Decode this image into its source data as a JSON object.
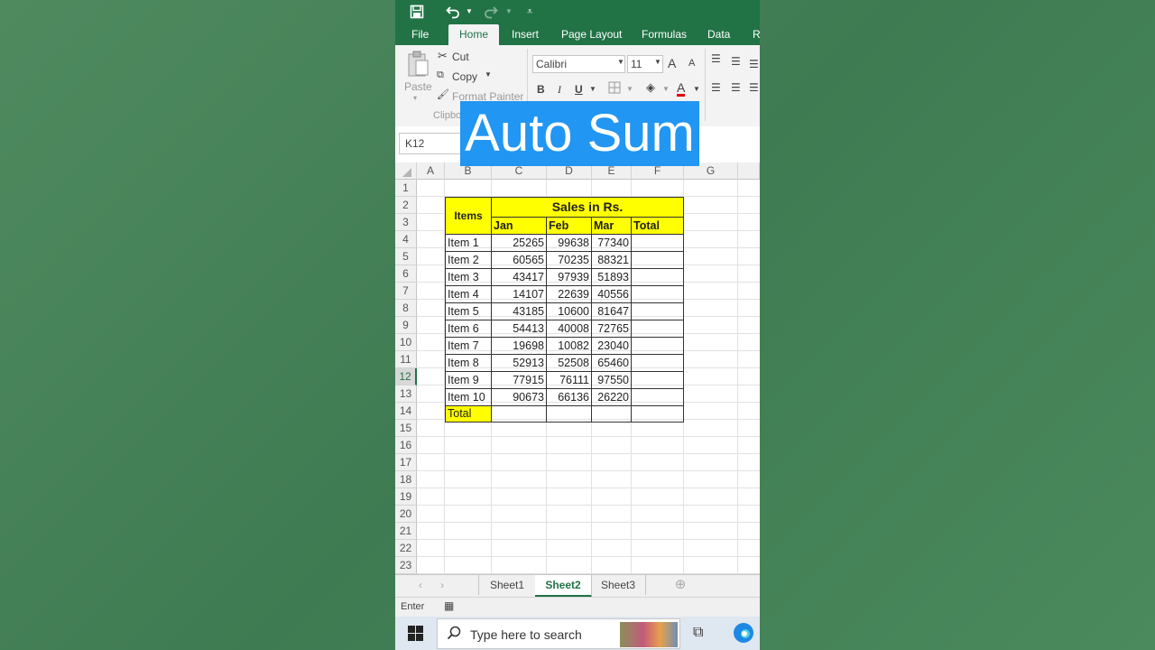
{
  "qat": {
    "save_icon": "save-icon",
    "undo_icon": "undo-icon",
    "redo_icon": "redo-icon",
    "customize_icon": "customize-icon"
  },
  "tabs": [
    "File",
    "Home",
    "Insert",
    "Page Layout",
    "Formulas",
    "Data",
    "R"
  ],
  "active_tab": "Home",
  "ribbon": {
    "paste": "Paste",
    "cut": "Cut",
    "copy": "Copy",
    "format_painter": "Format Painter",
    "clipboard_group": "Clipbo",
    "font_name": "Calibri",
    "font_size": "11",
    "grow_font": "A",
    "shrink_font": "A",
    "bold": "B",
    "italic": "I",
    "underline": "U",
    "font_color": "A"
  },
  "formula_bar": {
    "name_box": "K12"
  },
  "overlay_title": "Auto Sum",
  "columns": [
    "A",
    "B",
    "C",
    "D",
    "E",
    "F",
    "G"
  ],
  "rows": [
    "1",
    "2",
    "3",
    "4",
    "5",
    "6",
    "7",
    "8",
    "9",
    "10",
    "11",
    "12",
    "13",
    "14",
    "15",
    "16",
    "17",
    "18",
    "19",
    "20",
    "21",
    "22",
    "23"
  ],
  "selected_row": "12",
  "table": {
    "items_header": "Items",
    "sales_header": "Sales in Rs.",
    "months": [
      "Jan",
      "Feb",
      "Mar",
      "Total"
    ],
    "rows": [
      {
        "item": "Item 1",
        "jan": "25265",
        "feb": "99638",
        "mar": "77340"
      },
      {
        "item": "Item 2",
        "jan": "60565",
        "feb": "70235",
        "mar": "88321"
      },
      {
        "item": "Item 3",
        "jan": "43417",
        "feb": "97939",
        "mar": "51893"
      },
      {
        "item": "Item 4",
        "jan": "14107",
        "feb": "22639",
        "mar": "40556"
      },
      {
        "item": "Item 5",
        "jan": "43185",
        "feb": "10600",
        "mar": "81647"
      },
      {
        "item": "Item 6",
        "jan": "54413",
        "feb": "40008",
        "mar": "72765"
      },
      {
        "item": "Item 7",
        "jan": "19698",
        "feb": "10082",
        "mar": "23040"
      },
      {
        "item": "Item 8",
        "jan": "52913",
        "feb": "52508",
        "mar": "65460"
      },
      {
        "item": "Item 9",
        "jan": "77915",
        "feb": "76111",
        "mar": "97550"
      },
      {
        "item": "Item 10",
        "jan": "90673",
        "feb": "66136",
        "mar": "26220"
      }
    ],
    "total_label": "Total"
  },
  "sheets": [
    "Sheet1",
    "Sheet2",
    "Sheet3"
  ],
  "active_sheet": "Sheet2",
  "status": {
    "mode": "Enter"
  },
  "taskbar": {
    "search_placeholder": "Type here to search"
  },
  "colors": {
    "excel_green": "#217346",
    "highlight": "#ffff00",
    "overlay_blue": "#2196f3"
  }
}
